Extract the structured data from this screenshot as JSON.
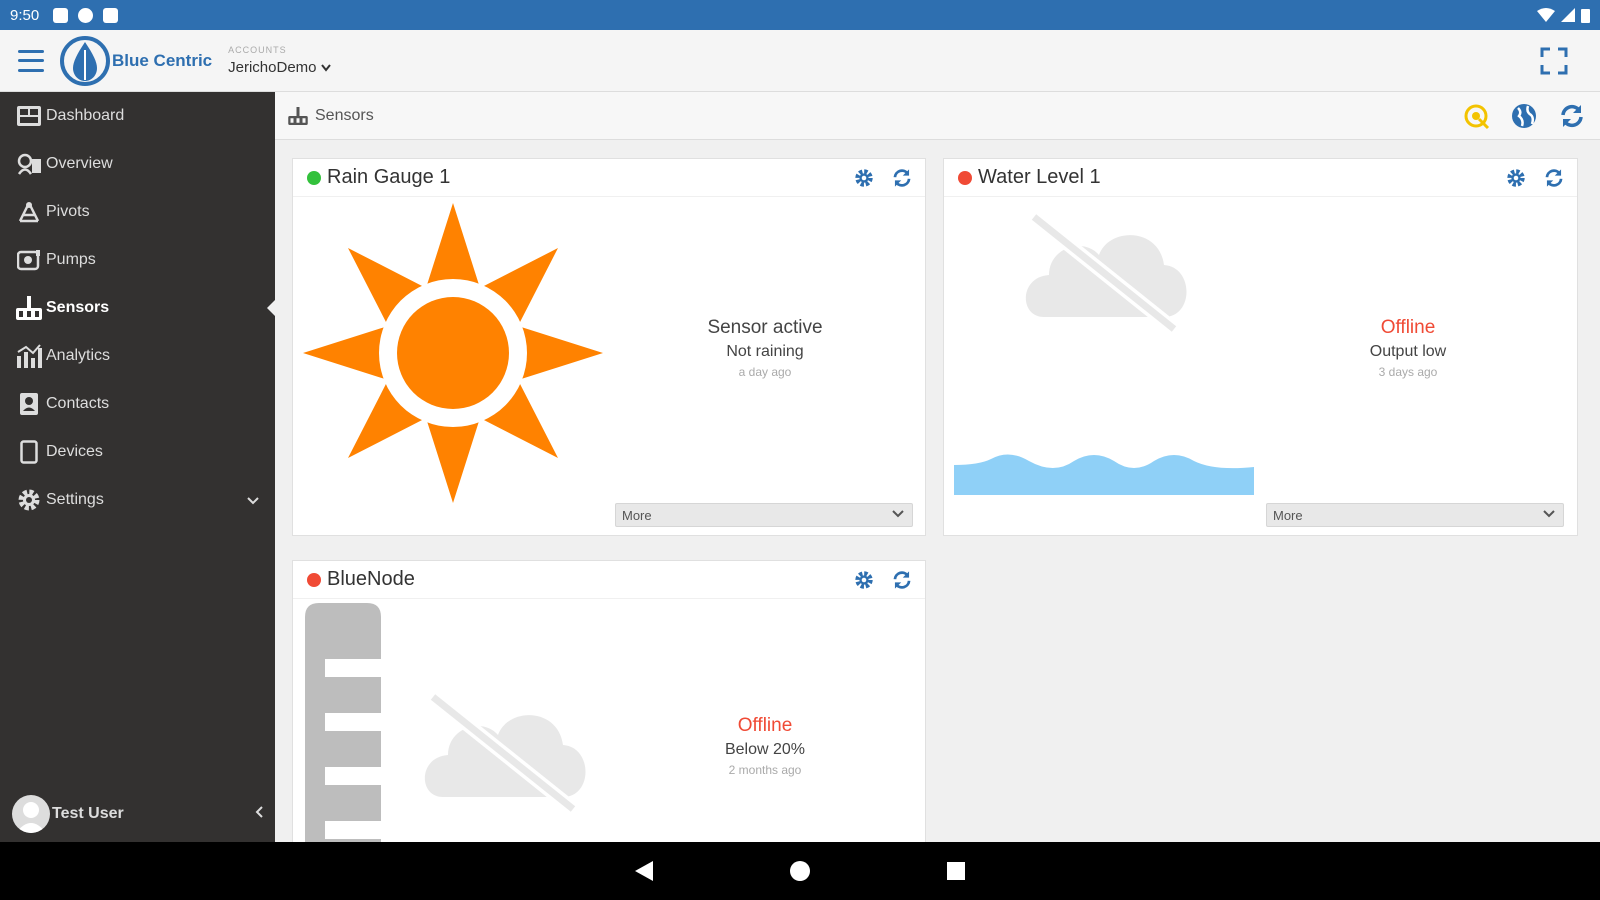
{
  "status_bar": {
    "time": "9:50"
  },
  "app": {
    "brand": "Blue Centric",
    "account_label": "ACCOUNTS",
    "account_value": "JerichoDemo"
  },
  "sidebar": {
    "items": [
      {
        "label": "Dashboard",
        "icon": "dashboard-icon"
      },
      {
        "label": "Overview",
        "icon": "overview-icon"
      },
      {
        "label": "Pivots",
        "icon": "pivot-icon"
      },
      {
        "label": "Pumps",
        "icon": "pump-icon"
      },
      {
        "label": "Sensors",
        "icon": "sensors-icon",
        "active": true
      },
      {
        "label": "Analytics",
        "icon": "analytics-icon"
      },
      {
        "label": "Contacts",
        "icon": "contacts-icon"
      },
      {
        "label": "Devices",
        "icon": "devices-icon"
      },
      {
        "label": "Settings",
        "icon": "gear-icon"
      }
    ],
    "user_name": "Test User"
  },
  "page": {
    "title": "Sensors"
  },
  "cards": [
    {
      "title": "Rain Gauge 1",
      "status_color": "#33c13c",
      "status": "Sensor active",
      "detail": "Not raining",
      "time": "a day ago",
      "more": "More"
    },
    {
      "title": "Water Level 1",
      "status_color": "#f04a35",
      "status": "Offline",
      "detail": "Output low",
      "time": "3 days ago",
      "more": "More"
    },
    {
      "title": "BlueNode",
      "status_color": "#f04a35",
      "status": "Offline",
      "detail": "Below 20%",
      "time": "2 months ago"
    }
  ],
  "colors": {
    "accent": "#2e6fb0",
    "sun": "#ff8200",
    "water": "#8fd0f7",
    "offline": "#f04a35",
    "active": "#33c13c"
  }
}
